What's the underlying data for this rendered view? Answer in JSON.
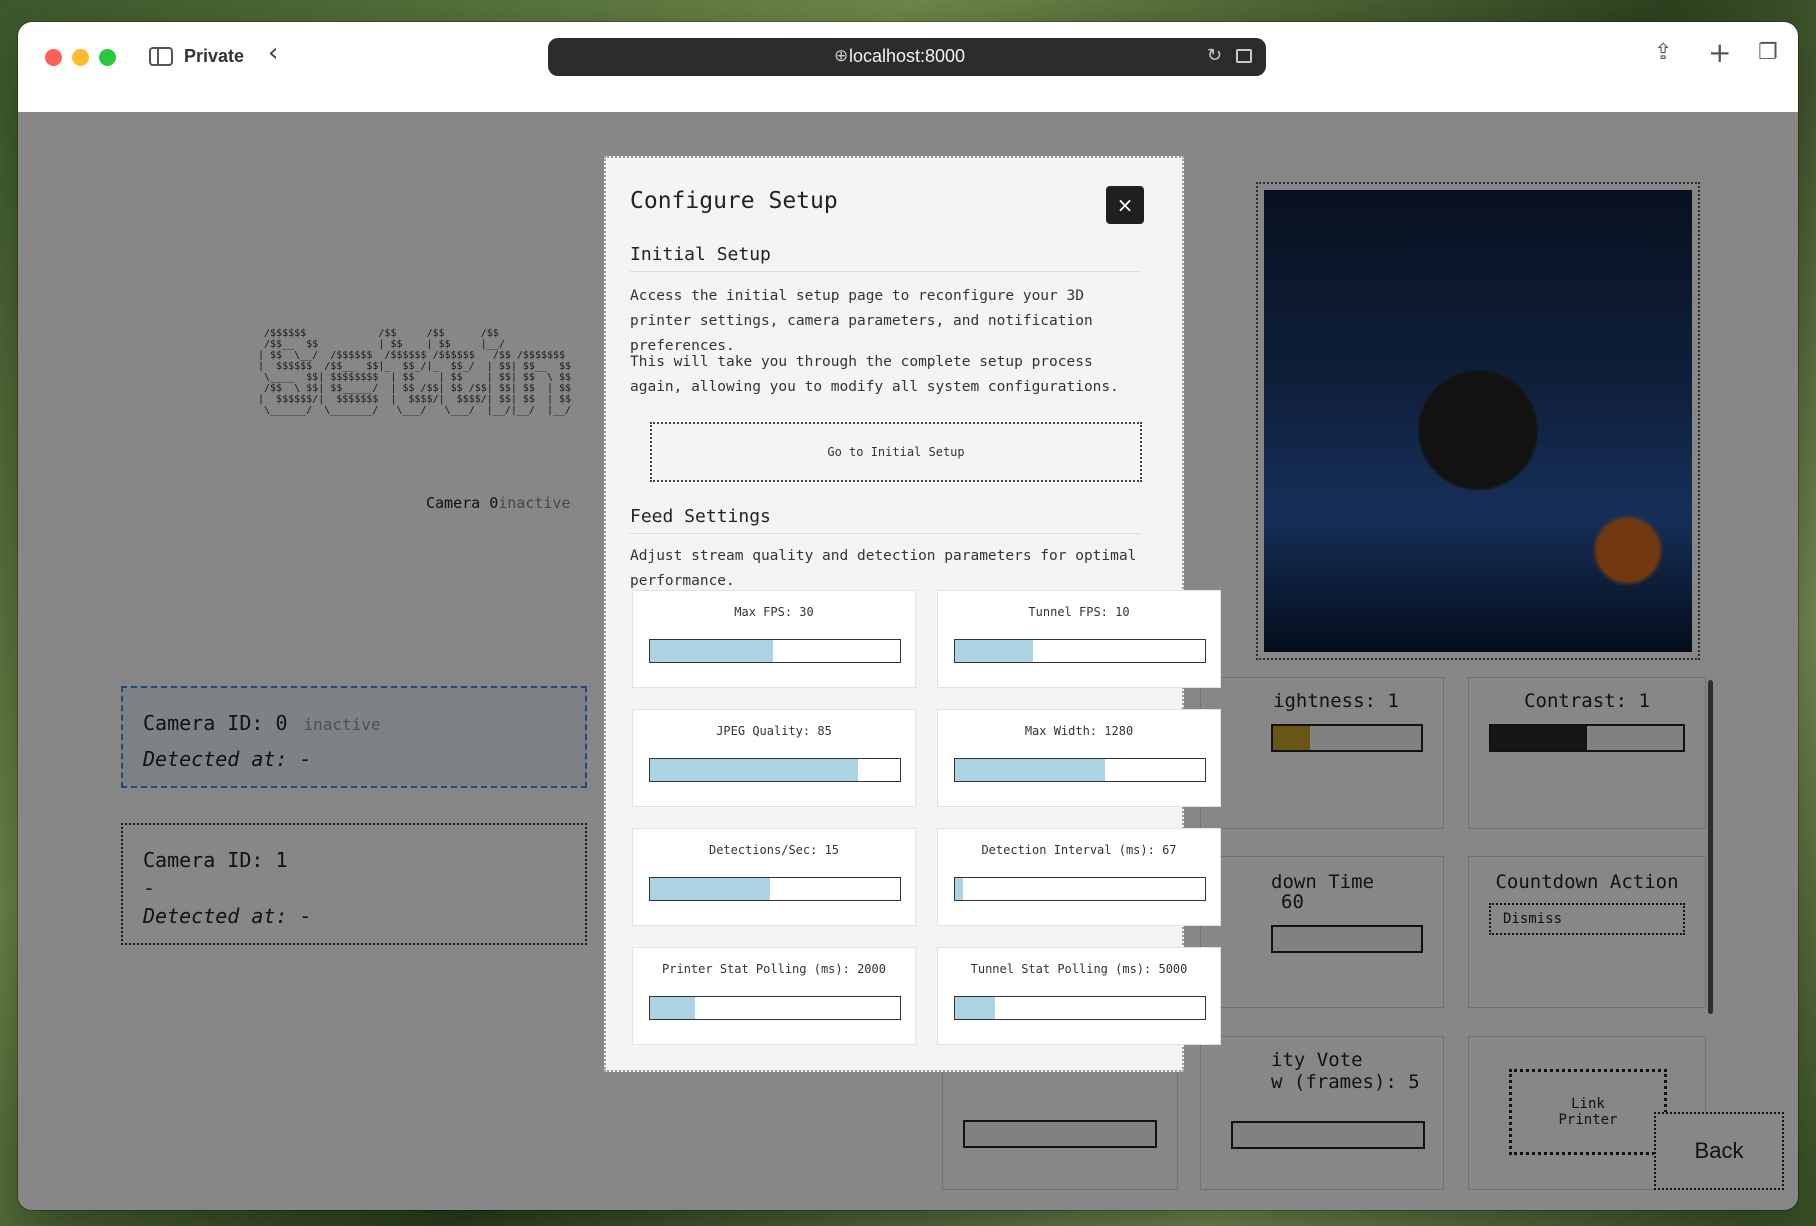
{
  "browser": {
    "private_label": "Private",
    "url": "localhost:8000"
  },
  "page": {
    "ascii_banner": " /$$$$$$            /$$     /$$      /$$\n /$$__  $$          | $$    | $$     |__/\n| $$  \\__/  /$$$$$$  /$$$$$$ /$$$$$$   /$$ /$$$$$$$\n|  $$$$$$  /$$__  $$|_  $$_/|_  $$_/  | $$| $$__  $$\n \\____  $$| $$$$$$$$  | $$    | $$    | $$| $$  \\ $$\n /$$  \\ $$| $$_____/  | $$ /$$| $$ /$$| $$| $$  | $$\n|  $$$$$$/|  $$$$$$$  |  $$$$/|  $$$$/| $$| $$  | $$\n \\______/  \\_______/   \\___/   \\___/  |__/|__/  |__/",
    "camera_caption": "Camera 0",
    "camera_caption_status": "inactive",
    "cameras": [
      {
        "id_label": "Camera ID: 0",
        "status": "inactive",
        "detected_label": "Detected at: -"
      },
      {
        "id_label": "Camera ID: 1",
        "status": "-",
        "detected_label": "Detected at: -"
      }
    ],
    "controls": {
      "brightness_label": "ightness: 1",
      "brightness_value": 0.25,
      "contrast_label": "Contrast: 1",
      "contrast_value": 0.5,
      "countdown_time_label": "down Time",
      "countdown_time_sub": "60",
      "countdown_action_label": "Countdown Action",
      "countdown_action_value": "Dismiss",
      "vote_label_1": "ity Vote",
      "vote_label_2": "w (frames): 5",
      "link_printer_label": "Link\nPrinter"
    },
    "back_label": "Back"
  },
  "modal": {
    "title": "Configure Setup",
    "close_label": "×",
    "initial_setup": {
      "title": "Initial Setup",
      "para1": "Access the initial setup page to reconfigure your 3D printer settings, camera parameters, and notification preferences.",
      "para2": "This will take you through the complete setup process again, allowing you to modify all system configurations.",
      "button_label": "Go to Initial Setup"
    },
    "feed_settings": {
      "title": "Feed Settings",
      "description": "Adjust stream quality and detection parameters for optimal performance.",
      "sliders": [
        {
          "label": "Max FPS: 30",
          "fraction": 0.49
        },
        {
          "label": "Tunnel FPS: 10",
          "fraction": 0.31
        },
        {
          "label": "JPEG Quality: 85",
          "fraction": 0.83
        },
        {
          "label": "Max Width: 1280",
          "fraction": 0.6
        },
        {
          "label": "Detections/Sec: 15",
          "fraction": 0.48
        },
        {
          "label": "Detection Interval (ms): 67",
          "fraction": 0.03
        },
        {
          "label": "Printer Stat Polling (ms): 2000",
          "fraction": 0.18
        },
        {
          "label": "Tunnel Stat Polling (ms): 5000",
          "fraction": 0.16
        }
      ]
    }
  },
  "colors": {
    "slider_fill": "#abd3e2",
    "brightness_fill": "#c9a52c",
    "contrast_fill": "#2a2a2a",
    "close_button": "#1f1f1f",
    "selected_camera_border": "#4a8bd6"
  }
}
